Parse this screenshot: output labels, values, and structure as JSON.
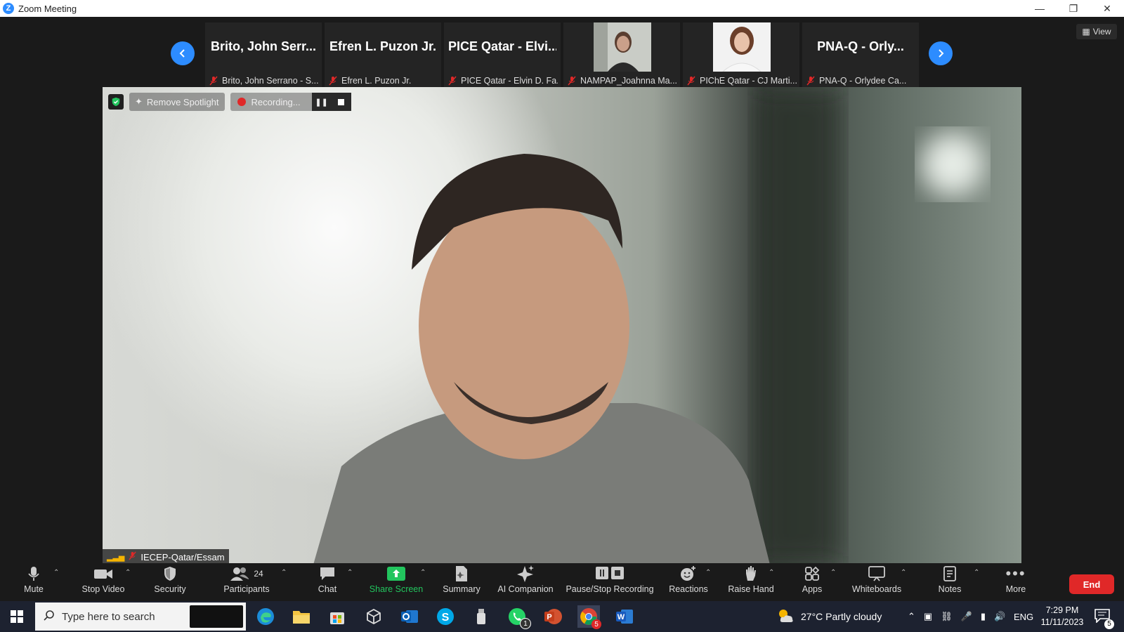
{
  "window": {
    "title": "Zoom Meeting"
  },
  "gallery": {
    "tiles": [
      {
        "name": "Brito, John Serr...",
        "label": "Brito, John Serrano - S..."
      },
      {
        "name": "Efren L. Puzon Jr.",
        "label": "Efren L. Puzon Jr."
      },
      {
        "name": "PICE Qatar - Elvi...",
        "label": "PICE Qatar - Elvin D. Fa..."
      },
      {
        "name": "",
        "label": "NAMPAP_Joahnna Ma..."
      },
      {
        "name": "",
        "label": "PIChE Qatar - CJ Marti..."
      },
      {
        "name": "PNA-Q  -  Orly...",
        "label": "PNA-Q  -  Orlydee Ca..."
      }
    ],
    "view_label": "View"
  },
  "video": {
    "remove_spotlight": "Remove Spotlight",
    "recording": "Recording...",
    "speaker": "IECEP-Qatar/Essam"
  },
  "toolbar": {
    "mute": "Mute",
    "stop_video": "Stop Video",
    "security": "Security",
    "participants": "Participants",
    "participants_count": "24",
    "chat": "Chat",
    "share_screen": "Share Screen",
    "summary": "Summary",
    "ai_companion": "AI Companion",
    "pause_stop_recording": "Pause/Stop Recording",
    "reactions": "Reactions",
    "raise_hand": "Raise Hand",
    "apps": "Apps",
    "whiteboards": "Whiteboards",
    "notes": "Notes",
    "more": "More",
    "end": "End"
  },
  "taskbar": {
    "search_placeholder": "Type here to search",
    "weather": "27°C  Partly cloudy",
    "language": "ENG",
    "time": "7:29 PM",
    "date": "11/11/2023",
    "notification_count": "5",
    "whatsapp_badge": "1",
    "chrome_badge": "5"
  },
  "colors": {
    "accent": "#2d8cff",
    "end": "#e02828",
    "share": "#22c55e"
  }
}
